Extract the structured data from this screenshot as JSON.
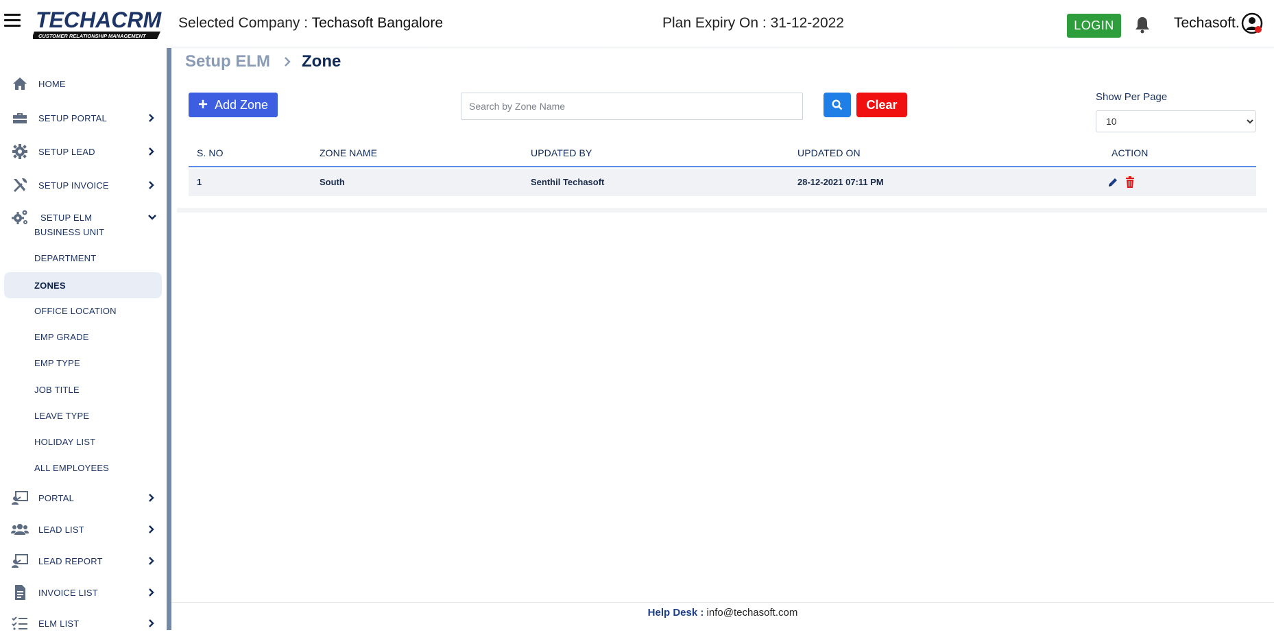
{
  "header": {
    "logo_text": "TECHACRM",
    "logo_tagline": "CUSTOMER RELATIONSHIP MANAGEMENT",
    "company_label": "Selected Company : ",
    "company_value": "Techasoft Bangalore",
    "plan_label": "Plan Expiry On : ",
    "plan_value": "31-12-2022",
    "login_label": "LOGIN",
    "username": "Techasoft.",
    "accent_green": "#2e9e3c"
  },
  "sidebar": {
    "items": [
      {
        "label": "HOME",
        "icon": "home-icon"
      },
      {
        "label": "SETUP PORTAL",
        "icon": "toolbox-icon"
      },
      {
        "label": "SETUP LEAD",
        "icon": "gear-icon"
      },
      {
        "label": "SETUP INVOICE",
        "icon": "tools-icon"
      },
      {
        "label": "SETUP ELM",
        "icon": "gears-icon"
      }
    ],
    "sub_items": [
      {
        "label": "BUSINESS UNIT"
      },
      {
        "label": "DEPARTMENT"
      },
      {
        "label": "ZONES"
      },
      {
        "label": "OFFICE LOCATION"
      },
      {
        "label": "EMP GRADE"
      },
      {
        "label": "EMP TYPE"
      },
      {
        "label": "JOB TITLE"
      },
      {
        "label": "LEAVE TYPE"
      },
      {
        "label": "HOLIDAY LIST"
      },
      {
        "label": "ALL EMPLOYEES"
      }
    ],
    "bottom_items": [
      {
        "label": "PORTAL",
        "icon": "presentation-icon"
      },
      {
        "label": "LEAD LIST",
        "icon": "users-icon"
      },
      {
        "label": "LEAD REPORT",
        "icon": "report-icon"
      },
      {
        "label": "INVOICE LIST",
        "icon": "document-icon"
      },
      {
        "label": "ELM LIST",
        "icon": "list-icon"
      }
    ]
  },
  "breadcrumb": {
    "parent": "Setup ELM",
    "current": "Zone"
  },
  "toolbar": {
    "add_label": "Add Zone",
    "search_placeholder": "Search by Zone Name",
    "clear_label": "Clear",
    "per_page_label": "Show Per Page",
    "per_page_value": "10"
  },
  "table": {
    "headers": [
      "S. NO",
      "ZONE NAME",
      "UPDATED BY",
      "UPDATED ON",
      "ACTION"
    ],
    "rows": [
      {
        "sno": "1",
        "zone": "South",
        "updated_by": "Senthil Techasoft",
        "updated_on": "28-12-2021 07:11 PM"
      }
    ]
  },
  "footer": {
    "label": "Help Desk : ",
    "email": "info@techasoft.com"
  }
}
